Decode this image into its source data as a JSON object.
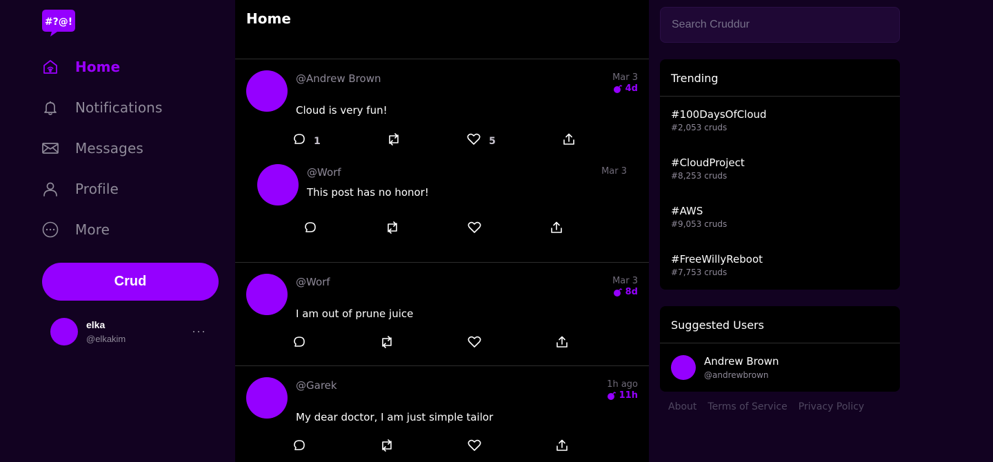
{
  "app": {
    "logo_text": "#?@!",
    "brand_color": "#9500ff"
  },
  "nav": {
    "items": [
      {
        "label": "Home",
        "icon": "home-icon",
        "active": true
      },
      {
        "label": "Notifications",
        "icon": "bell-icon",
        "active": false
      },
      {
        "label": "Messages",
        "icon": "mail-icon",
        "active": false
      },
      {
        "label": "Profile",
        "icon": "user-icon",
        "active": false
      },
      {
        "label": "More",
        "icon": "more-circle-icon",
        "active": false
      }
    ],
    "crud_label": "Crud"
  },
  "current_user": {
    "name": "elka",
    "handle": "@elkakim",
    "more": "···"
  },
  "feed": {
    "title": "Home",
    "activities": [
      {
        "handle": "@Andrew Brown",
        "message": "Cloud is very fun!",
        "date": "Mar 3",
        "expires": "4d",
        "replies": "1",
        "likes": "5",
        "reply": {
          "handle": "@Worf",
          "message": "This post has no honor!",
          "date": "Mar 3"
        }
      },
      {
        "handle": "@Worf",
        "message": "I am out of prune juice",
        "date": "Mar 3",
        "expires": "8d"
      },
      {
        "handle": "@Garek",
        "message": "My dear doctor, I am just simple tailor",
        "date": "1h ago",
        "expires": "11h"
      }
    ]
  },
  "search": {
    "placeholder": "Search Cruddur"
  },
  "trending": {
    "title": "Trending",
    "items": [
      {
        "tag": "#100DaysOfCloud",
        "count": "#2,053 cruds"
      },
      {
        "tag": "#CloudProject",
        "count": "#8,253 cruds"
      },
      {
        "tag": "#AWS",
        "count": "#9,053 cruds"
      },
      {
        "tag": "#FreeWillyReboot",
        "count": "#7,753 cruds"
      }
    ]
  },
  "suggested": {
    "title": "Suggested Users",
    "users": [
      {
        "name": "Andrew Brown",
        "handle": "@andrewbrown"
      }
    ]
  },
  "footer": {
    "links": [
      "About",
      "Terms of Service",
      "Privacy Policy"
    ]
  }
}
